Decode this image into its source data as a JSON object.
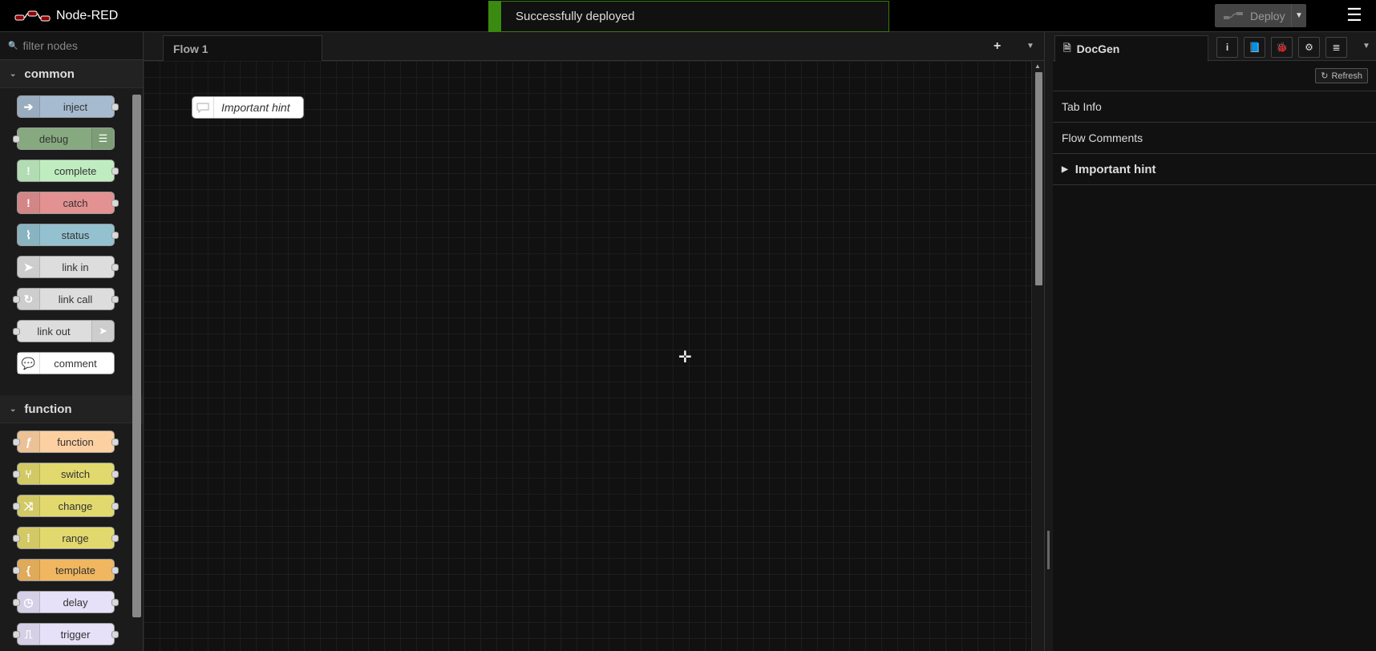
{
  "header": {
    "title": "Node-RED",
    "deploy_label": "Deploy",
    "notification": "Successfully deployed"
  },
  "palette": {
    "search_placeholder": "filter nodes",
    "categories": [
      {
        "label": "common",
        "nodes": [
          {
            "label": "inject",
            "color": "#a6bbcf"
          },
          {
            "label": "debug",
            "color": "#87a980"
          },
          {
            "label": "complete",
            "color": "#c0edc0"
          },
          {
            "label": "catch",
            "color": "#e49191"
          },
          {
            "label": "status",
            "color": "#94c1d0"
          },
          {
            "label": "link in",
            "color": "#dddddd"
          },
          {
            "label": "link call",
            "color": "#dddddd"
          },
          {
            "label": "link out",
            "color": "#dddddd"
          },
          {
            "label": "comment",
            "color": "#ffffff"
          }
        ]
      },
      {
        "label": "function",
        "nodes": [
          {
            "label": "function",
            "color": "#fdd0a2"
          },
          {
            "label": "switch",
            "color": "#e2d96e"
          },
          {
            "label": "change",
            "color": "#e2d96e"
          },
          {
            "label": "range",
            "color": "#e2d96e"
          },
          {
            "label": "template",
            "color": "#f0b760"
          },
          {
            "label": "delay",
            "color": "#e6e0f8"
          },
          {
            "label": "trigger",
            "color": "#e6e0f8"
          }
        ]
      }
    ]
  },
  "workspace": {
    "tab_label": "Flow 1",
    "comment_node_label": "Important hint"
  },
  "sidebar": {
    "tab_label": "DocGen",
    "refresh_label": "Refresh",
    "rows": [
      "Tab Info",
      "Flow Comments"
    ],
    "expandable": "Important hint"
  }
}
